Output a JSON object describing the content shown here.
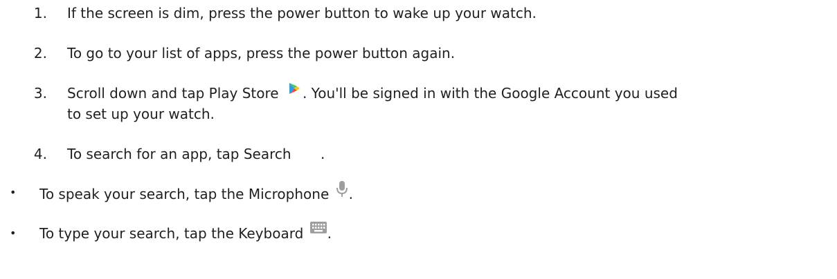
{
  "steps": [
    {
      "number": "1.",
      "text": "If the screen is dim, press the power button to wake up your watch."
    },
    {
      "number": "2.",
      "text": "To go to your list of apps, press the power button again."
    },
    {
      "number": "3.",
      "text_before": "Scroll down and tap Play Store",
      "icon": "play-store-icon",
      "text_after": ". You'll be signed in with the Google Account you used",
      "text_continued": "to set up your watch."
    },
    {
      "number": "4.",
      "text": "To search for an app, tap Search",
      "trailing": "."
    }
  ],
  "bullets": [
    {
      "marker": "•",
      "text": "To speak your search, tap the Microphone",
      "icon": "microphone-icon",
      "trailing": "."
    },
    {
      "marker": "•",
      "text": "To type your search, tap the Keyboard",
      "icon": "keyboard-icon",
      "trailing": "."
    }
  ],
  "colors": {
    "text": "#1f1f1f",
    "icon_gray": "#9e9e9e",
    "play_blue": "#2f9be4",
    "play_green": "#46c36c",
    "play_yellow": "#ffc31f",
    "play_red": "#ee4a3c"
  }
}
